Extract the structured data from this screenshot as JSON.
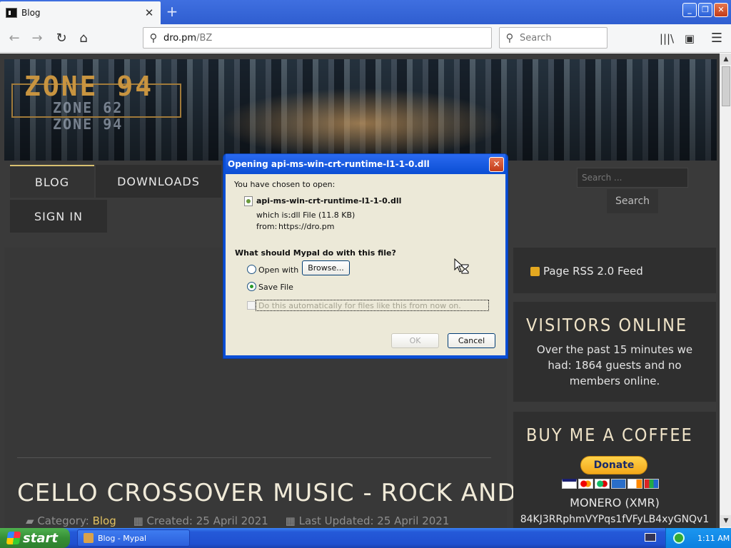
{
  "browser": {
    "tab_title": "Blog",
    "url_host": "dro.pm",
    "url_path": "/BZ",
    "search_placeholder": "Search"
  },
  "site": {
    "logo": {
      "main": "ZONE 94",
      "sub1": "ZONE 62",
      "sub2": "ZONE 94"
    },
    "menu": {
      "blog": "BLOG",
      "downloads": "DOWNLOADS",
      "signin": "SIGN IN"
    },
    "search": {
      "placeholder": "Search ...",
      "button": "Search"
    },
    "article": {
      "title": "CELLO CROSSOVER MUSIC - ROCK AND METAL",
      "category_label": "Category: ",
      "category": "Blog",
      "created": "Created: 25 April 2021",
      "updated": "Last Updated: 25 April 2021"
    },
    "sidebar": {
      "rss": "Page RSS 2.0 Feed",
      "visitors_title": "VISITORS ONLINE",
      "visitors_text": "Over the past 15 minutes we had: 1864 guests and no members online.",
      "coffee_title": "BUY ME A COFFEE",
      "donate": "Donate",
      "monero": "MONERO (XMR)",
      "monero_addr": "84KJ3RRphmVYPqs1fVFyLB4xyGNQv1"
    }
  },
  "dialog": {
    "title": "Opening api-ms-win-crt-runtime-l1-1-0.dll",
    "chosen": "You have chosen to open:",
    "filename": "api-ms-win-crt-runtime-l1-1-0.dll",
    "which_is_label": "which is:",
    "which_is_value": ".dll File (11.8 KB)",
    "from_label": "from:",
    "from_value": "https://dro.pm",
    "question": "What should Mypal do with this file?",
    "open_with": "Open with",
    "browse": "Browse...",
    "save_file": "Save File",
    "auto": "Do this automatically for files like this from now on.",
    "ok": "OK",
    "cancel": "Cancel"
  },
  "taskbar": {
    "start": "start",
    "task": "Blog - Mypal",
    "clock": "1:11 AM"
  },
  "colors": {
    "accent_gold": "#e0c060",
    "xp_blue": "#0b4fd6",
    "start_green": "#358f35"
  }
}
